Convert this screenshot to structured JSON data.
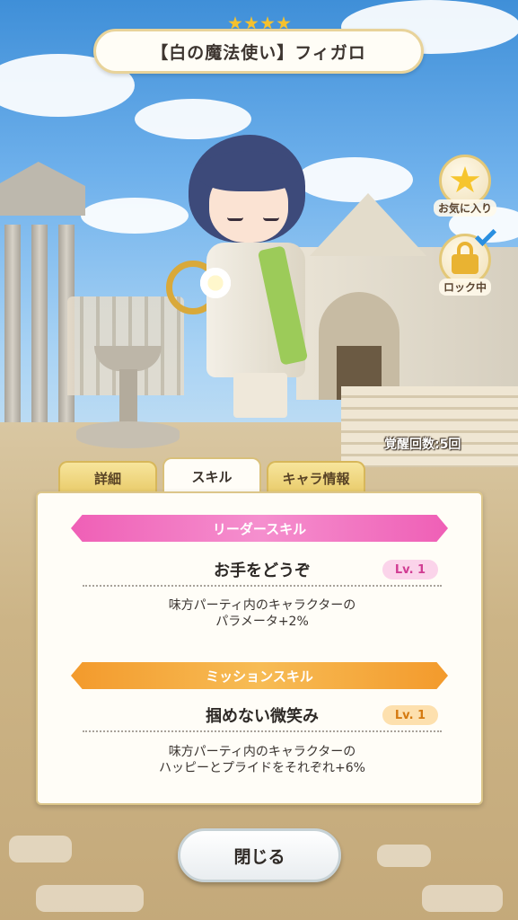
{
  "header": {
    "rarity_stars": 4,
    "title": "【白の魔法使い】フィガロ"
  },
  "side_buttons": {
    "favorite_label": "お気に入り",
    "lock_label": "ロック中"
  },
  "awakening_text": "覚醒回数:5回",
  "tabs": [
    {
      "label": "詳細",
      "active": false
    },
    {
      "label": "スキル",
      "active": true
    },
    {
      "label": "キャラ情報",
      "active": false
    }
  ],
  "leader_skill": {
    "header": "リーダースキル",
    "name": "お手をどうぞ",
    "level": "Lv. 1",
    "desc_line1": "味方パーティ内のキャラクターの",
    "desc_line2": "パラメータ+2%"
  },
  "mission_skill": {
    "header": "ミッションスキル",
    "name": "掴めない微笑み",
    "level": "Lv. 1",
    "desc_line1": "味方パーティ内のキャラクターの",
    "desc_line2": "ハッピーとプライドをそれぞれ+6%"
  },
  "close_button": {
    "label": "閉じる"
  },
  "colors": {
    "leader_accent": "#ef5fb6",
    "mission_accent": "#f39a2c",
    "tab_gold": "#e9cb6a",
    "star_gold": "#f5c12e"
  }
}
